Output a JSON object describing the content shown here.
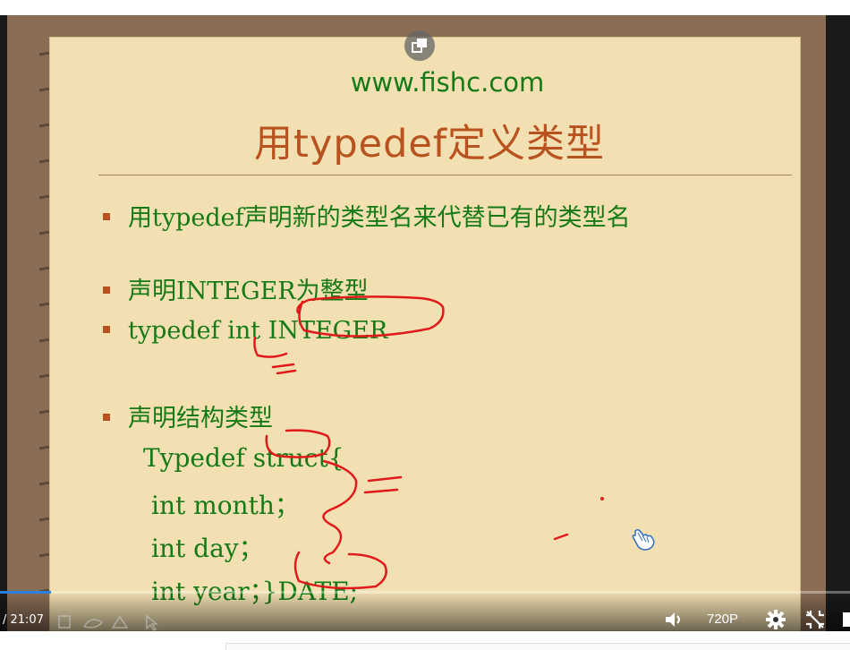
{
  "slide": {
    "site": "www.fishc.com",
    "title": "用typedef定义类型",
    "bullets": [
      "用typedef声明新的类型名来代替已有的类型名",
      "声明INTEGER为整型",
      "typedef  int  INTEGER",
      "声明结构类型"
    ],
    "code": [
      "Typedef  struct{",
      "int month；",
      "int day；",
      "int year；}DATE;"
    ]
  },
  "player": {
    "time": "/ 21:07",
    "quality": "720P",
    "progress_fraction": 0.06
  },
  "icons": {
    "popout": "picture-in-picture-icon",
    "volume": "volume-icon",
    "settings": "gear-icon",
    "fullscreen": "fullscreen-off-icon",
    "cursor": "hand-cursor-icon"
  },
  "colors": {
    "text_green": "#157a15",
    "title_orange": "#b8521f",
    "paper": "#f3e0b2",
    "ink_red": "#e01a1a",
    "progress": "#2b7fe0"
  }
}
